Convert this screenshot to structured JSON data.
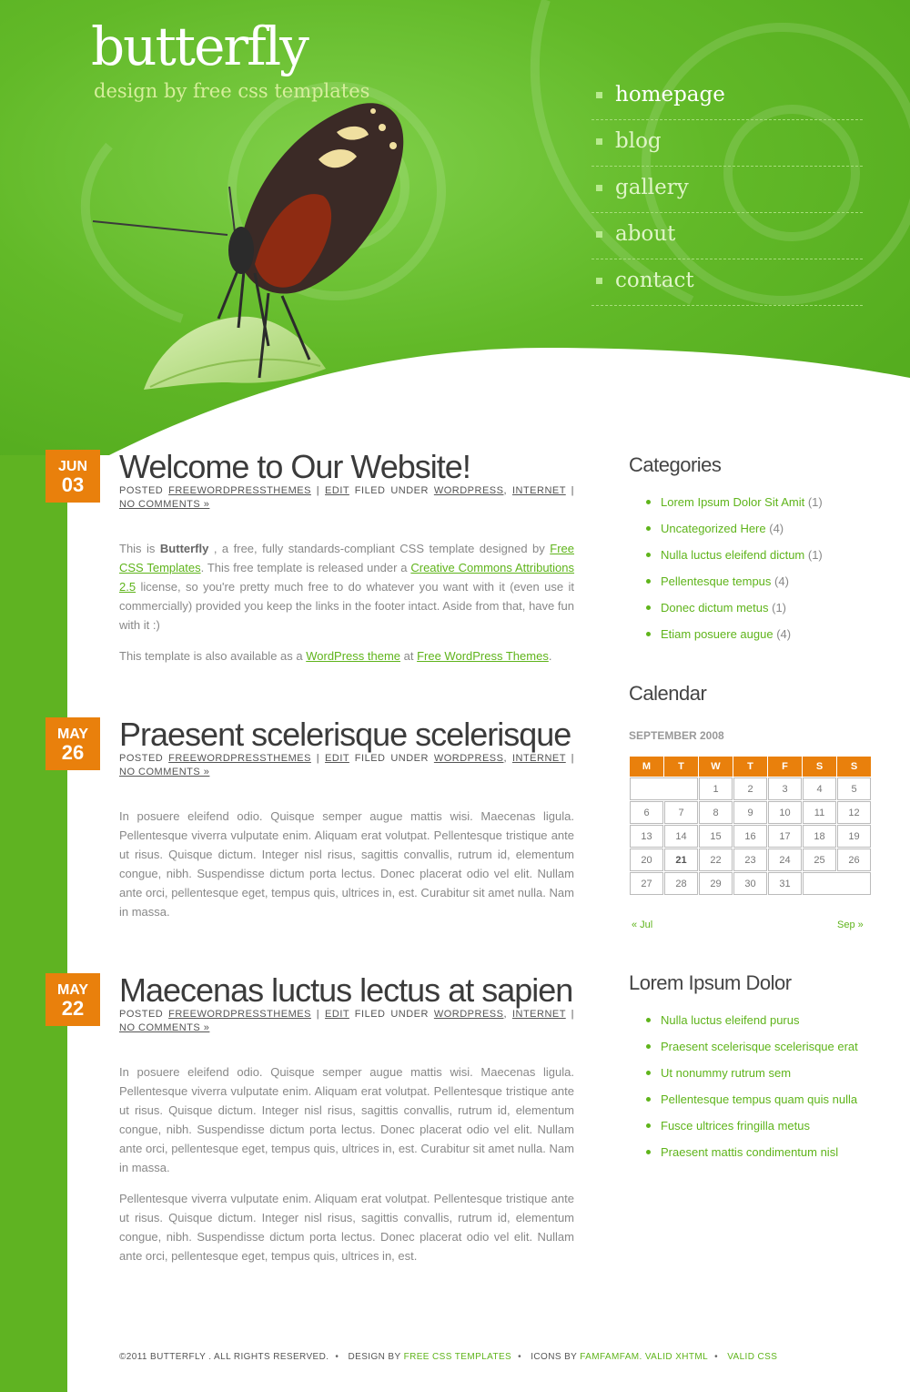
{
  "colors": {
    "green": "#5fb322",
    "orange": "#e9800c",
    "link": "#5fb41b"
  },
  "logo": {
    "title": "butterfly",
    "subtitle": "design by free css templates"
  },
  "menu": [
    {
      "label": "homepage",
      "current": true
    },
    {
      "label": "blog"
    },
    {
      "label": "gallery"
    },
    {
      "label": "about"
    },
    {
      "label": "contact"
    }
  ],
  "posts": [
    {
      "month": "JUN",
      "day": "03",
      "title": "Welcome to Our Website!",
      "meta": {
        "posted": "POSTED",
        "author": "FREEWORDPRESSTHEMES",
        "edit": "EDIT",
        "filed": "FILED UNDER",
        "cat1": "WORDPRESS",
        "cat2": "INTERNET",
        "comments": "NO COMMENTS »"
      },
      "p1": {
        "t1": "This is ",
        "bold": "Butterfly",
        "t2": " , a free, fully standards-compliant CSS template designed by ",
        "link1": "Free CSS Templates",
        "t3": ". This free template is released under a ",
        "link2": "Creative Commons Attributions 2.5",
        "t4": " license, so you're pretty much free to do whatever you want with it (even use it commercially) provided you keep the links in the footer intact. Aside from that, have fun with it :)"
      },
      "p2": {
        "t1": "This template is also available as a ",
        "link1": "WordPress theme",
        "t2": " at ",
        "link2": "Free WordPress Themes",
        "t3": "."
      }
    },
    {
      "month": "MAY",
      "day": "26",
      "title": "Praesent scelerisque scelerisque",
      "meta": {
        "posted": "POSTED",
        "author": "FREEWORDPRESSTHEMES",
        "edit": "EDIT",
        "filed": "FILED UNDER",
        "cat1": "WORDPRESS",
        "cat2": "INTERNET",
        "comments": "NO COMMENTS »"
      },
      "p1": "In posuere eleifend odio. Quisque semper augue mattis wisi. Maecenas ligula. Pellentesque viverra vulputate enim. Aliquam erat volutpat. Pellentesque tristique ante ut risus. Quisque dictum. Integer nisl risus, sagittis convallis, rutrum id, elementum congue, nibh. Suspendisse dictum porta lectus. Donec placerat odio vel elit. Nullam ante orci, pellentesque eget, tempus quis, ultrices in, est. Curabitur sit amet nulla. Nam in massa."
    },
    {
      "month": "MAY",
      "day": "22",
      "title": "Maecenas luctus lectus at sapien",
      "meta": {
        "posted": "POSTED",
        "author": "FREEWORDPRESSTHEMES",
        "edit": "EDIT",
        "filed": "FILED UNDER",
        "cat1": "WORDPRESS",
        "cat2": "INTERNET",
        "comments": "NO COMMENTS »"
      },
      "p1": "In posuere eleifend odio. Quisque semper augue mattis wisi. Maecenas ligula. Pellentesque viverra vulputate enim. Aliquam erat volutpat. Pellentesque tristique ante ut risus. Quisque dictum. Integer nisl risus, sagittis convallis, rutrum id, elementum congue, nibh. Suspendisse dictum porta lectus. Donec placerat odio vel elit. Nullam ante orci, pellentesque eget, tempus quis, ultrices in, est. Curabitur sit amet nulla. Nam in massa.",
      "p2": "Pellentesque viverra vulputate enim. Aliquam erat volutpat. Pellentesque tristique ante ut risus. Quisque dictum. Integer nisl risus, sagittis convallis, rutrum id, elementum congue, nibh. Suspendisse dictum porta lectus. Donec placerat odio vel elit. Nullam ante orci, pellentesque eget, tempus quis, ultrices in, est."
    }
  ],
  "sidebar": {
    "categories": {
      "title": "Categories",
      "items": [
        {
          "label": "Lorem Ipsum Dolor Sit Amit",
          "count": "(1)"
        },
        {
          "label": "Uncategorized Here",
          "count": "(4)"
        },
        {
          "label": "Nulla luctus eleifend dictum",
          "count": "(1)"
        },
        {
          "label": "Pellentesque tempus",
          "count": "(4)"
        },
        {
          "label": "Donec dictum metus",
          "count": "(1)"
        },
        {
          "label": "Etiam posuere augue",
          "count": "(4)"
        }
      ]
    },
    "calendar": {
      "title": "Calendar",
      "caption": "SEPTEMBER 2008",
      "headers": [
        "M",
        "T",
        "W",
        "T",
        "F",
        "S",
        "S"
      ],
      "weeks": [
        [
          {
            "blank": true,
            "span": 2
          },
          "1",
          "2",
          "3",
          "4",
          "5"
        ],
        [
          "6",
          "7",
          "8",
          "9",
          "10",
          "11",
          "12"
        ],
        [
          "13",
          "14",
          "15",
          "16",
          "17",
          "18",
          "19"
        ],
        [
          "20",
          "21",
          "22",
          "23",
          "24",
          "25",
          "26"
        ],
        [
          "27",
          "28",
          "29",
          "30",
          "31",
          {
            "blank": true,
            "span": 2
          }
        ]
      ],
      "today": "21",
      "prev": "« Jul",
      "next": "Sep »"
    },
    "lorem": {
      "title": "Lorem Ipsum Dolor",
      "items": [
        "Nulla luctus eleifend purus",
        "Praesent scelerisque scelerisque erat",
        "Ut nonummy rutrum sem",
        "Pellentesque tempus quam quis nulla",
        "Fusce ultrices fringilla metus",
        "Praesent mattis condimentum nisl"
      ]
    }
  },
  "footer": {
    "copyright": "©2011 BUTTERFLY . ALL RIGHTS RESERVED.",
    "design_by": "DESIGN BY",
    "design_link": "FREE CSS TEMPLATES",
    "icons_by": "ICONS BY",
    "icons_link": "FAMFAMFAM.",
    "xhtml": "VALID XHTML",
    "css": "VALID CSS"
  }
}
